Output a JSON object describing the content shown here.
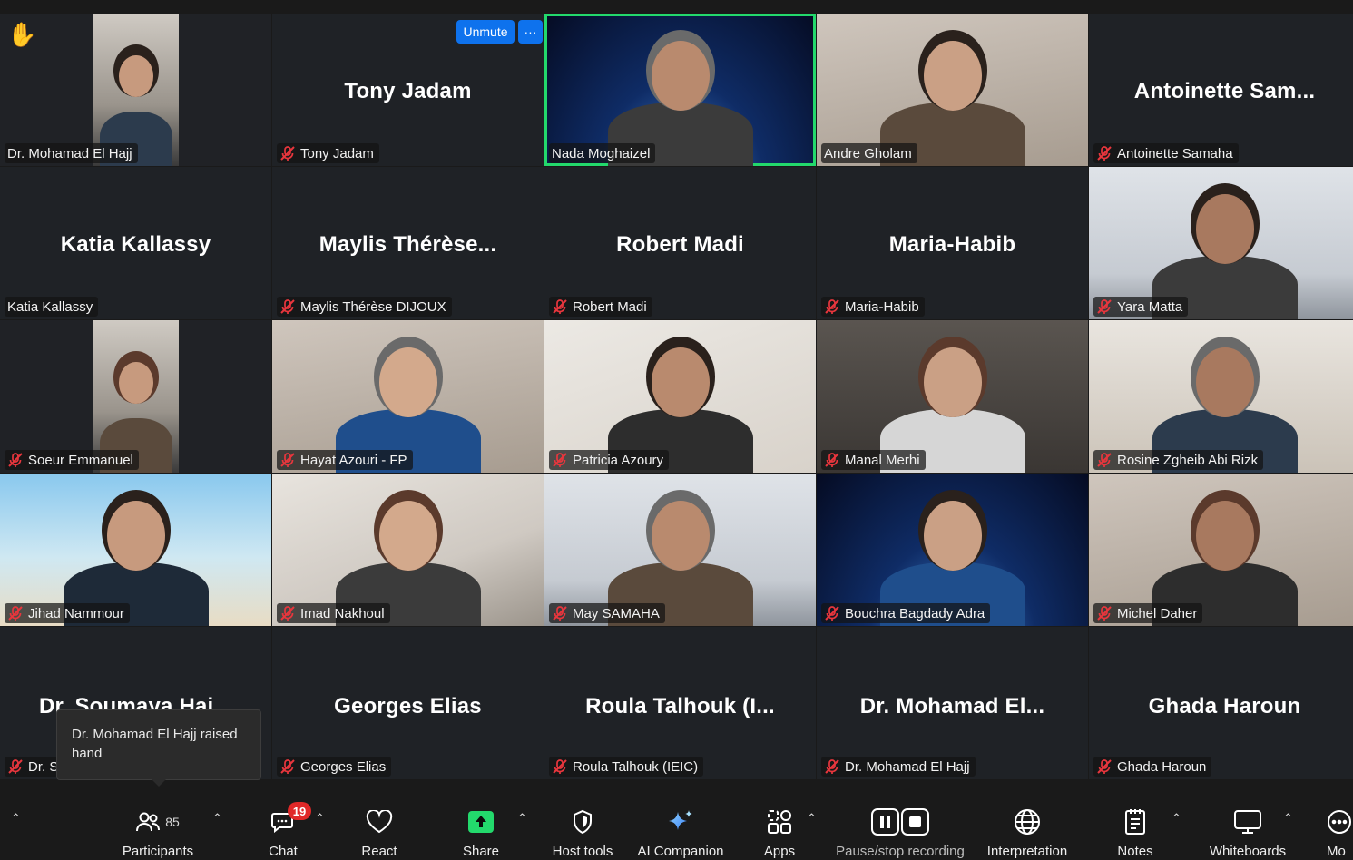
{
  "meeting": {
    "hand_icon": "raised-hand-icon",
    "unmute_label": "Unmute",
    "more_label": "···",
    "tooltip": "Dr. Mohamad El Hajj raised hand"
  },
  "participants": [
    {
      "tag": "Dr. Mohamad El Hajj",
      "big": "",
      "muted": false,
      "video": true
    },
    {
      "tag": "Tony Jadam",
      "big": "Tony Jadam",
      "muted": true,
      "video": false
    },
    {
      "tag": "Nada Moghaizel",
      "big": "",
      "muted": false,
      "video": true
    },
    {
      "tag": "Andre Gholam",
      "big": "",
      "muted": false,
      "video": true
    },
    {
      "tag": "Antoinette Samaha",
      "big": "Antoinette  Sam...",
      "muted": true,
      "video": false
    },
    {
      "tag": "Katia Kallassy",
      "big": "Katia Kallassy",
      "muted": false,
      "video": false
    },
    {
      "tag": "Maylis Thérèse DIJOUX",
      "big": "Maylis  Thérèse...",
      "muted": true,
      "video": false
    },
    {
      "tag": "Robert Madi",
      "big": "Robert Madi",
      "muted": true,
      "video": false
    },
    {
      "tag": "Maria-Habib",
      "big": "Maria-Habib",
      "muted": true,
      "video": false
    },
    {
      "tag": "Yara Matta",
      "big": "",
      "muted": true,
      "video": true
    },
    {
      "tag": "Soeur  Emmanuel",
      "big": "",
      "muted": true,
      "video": true
    },
    {
      "tag": "Hayat Azouri - FP",
      "big": "",
      "muted": true,
      "video": true
    },
    {
      "tag": "Patricia Azoury",
      "big": "",
      "muted": true,
      "video": true
    },
    {
      "tag": "Manal Merhi",
      "big": "",
      "muted": true,
      "video": true
    },
    {
      "tag": "Rosine Zgheib Abi Rizk",
      "big": "",
      "muted": true,
      "video": true
    },
    {
      "tag": "Jihad Nammour",
      "big": "",
      "muted": true,
      "video": true
    },
    {
      "tag": "Imad Nakhoul",
      "big": "",
      "muted": true,
      "video": true
    },
    {
      "tag": "May SAMAHA",
      "big": "",
      "muted": true,
      "video": true
    },
    {
      "tag": "Bouchra Bagdady Adra",
      "big": "",
      "muted": true,
      "video": true
    },
    {
      "tag": "Michel Daher",
      "big": "",
      "muted": true,
      "video": true
    },
    {
      "tag": "Dr. S",
      "big": "Dr. Soumaya Haj...",
      "muted": true,
      "video": false
    },
    {
      "tag": "Georges Elias",
      "big": "Georges Elias",
      "muted": true,
      "video": false
    },
    {
      "tag": "Roula Talhouk (IEIC)",
      "big": "Roula  Talhouk  (I...",
      "muted": true,
      "video": false
    },
    {
      "tag": "Dr. Mohamad El Hajj",
      "big": "Dr.  Mohamad  El...",
      "muted": true,
      "video": false
    },
    {
      "tag": "Ghada Haroun",
      "big": "Ghada Haroun",
      "muted": true,
      "video": false
    }
  ],
  "toolbar": {
    "participants_label": "Participants",
    "participants_count": "85",
    "chat_label": "Chat",
    "chat_badge": "19",
    "react_label": "React",
    "share_label": "Share",
    "host_tools_label": "Host tools",
    "ai_companion_label": "AI Companion",
    "apps_label": "Apps",
    "recording_label": "Pause/stop recording",
    "interpretation_label": "Interpretation",
    "notes_label": "Notes",
    "whiteboards_label": "Whiteboards",
    "more_label": "Mo",
    "caret": "⌃"
  },
  "colors": {
    "active_speaker": "#23d96c",
    "unmute_button": "#0e72ed",
    "share_green": "#23d96c",
    "badge_red": "#e02828",
    "mic_muted": "#e8363d"
  }
}
